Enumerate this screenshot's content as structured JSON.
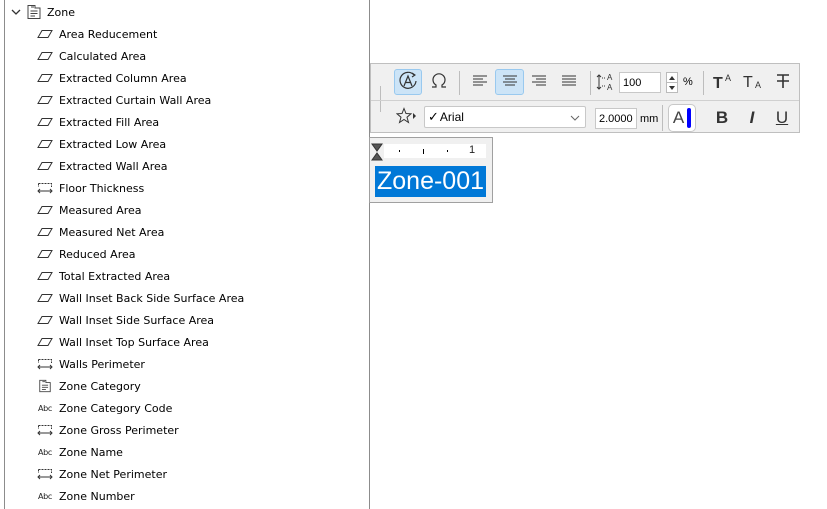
{
  "tree": {
    "root": {
      "label": "Zone",
      "expanded": true,
      "icon": "zone-stamp-icon"
    },
    "items": [
      {
        "label": "Area Reducement",
        "icon": "area-icon"
      },
      {
        "label": "Calculated Area",
        "icon": "area-icon"
      },
      {
        "label": "Extracted Column Area",
        "icon": "area-icon"
      },
      {
        "label": "Extracted Curtain Wall Area",
        "icon": "area-icon"
      },
      {
        "label": "Extracted Fill Area",
        "icon": "area-icon"
      },
      {
        "label": "Extracted Low Area",
        "icon": "area-icon"
      },
      {
        "label": "Extracted Wall Area",
        "icon": "area-icon"
      },
      {
        "label": "Floor Thickness",
        "icon": "length-icon"
      },
      {
        "label": "Measured Area",
        "icon": "area-icon"
      },
      {
        "label": "Measured Net Area",
        "icon": "area-icon"
      },
      {
        "label": "Reduced Area",
        "icon": "area-icon"
      },
      {
        "label": "Total Extracted Area",
        "icon": "area-icon"
      },
      {
        "label": "Wall Inset Back Side Surface Area",
        "icon": "area-icon"
      },
      {
        "label": "Wall Inset Side Surface Area",
        "icon": "area-icon"
      },
      {
        "label": "Wall Inset Top Surface Area",
        "icon": "area-icon"
      },
      {
        "label": "Walls Perimeter",
        "icon": "length-icon"
      },
      {
        "label": "Zone Category",
        "icon": "zone-stamp-icon"
      },
      {
        "label": "Zone Category Code",
        "icon": "text-abc-icon"
      },
      {
        "label": "Zone Gross Perimeter",
        "icon": "length-icon"
      },
      {
        "label": "Zone Name",
        "icon": "text-abc-icon"
      },
      {
        "label": "Zone Net Perimeter",
        "icon": "length-icon"
      },
      {
        "label": "Zone Number",
        "icon": "text-abc-icon"
      }
    ],
    "abc_glyph": "Abc"
  },
  "toolbar": {
    "line_spacing_value": "100",
    "line_spacing_unit": "%",
    "font_name": "Arial",
    "font_check": "✓",
    "font_size_value": "2.0000",
    "font_size_unit": "mm",
    "color_glyph": "A",
    "accent_color": "#0000ff",
    "bold_glyph": "B",
    "italic_glyph": "I",
    "underline_glyph": "U",
    "autotext_active": true,
    "align_center_active": true
  },
  "preview": {
    "ruler_mark": "1",
    "zone_text": "Zone-001",
    "selection_color": "#0078d7"
  }
}
